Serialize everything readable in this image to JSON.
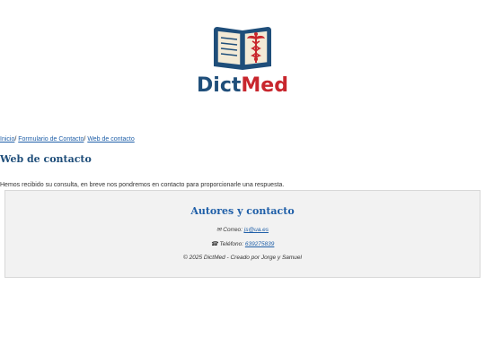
{
  "logo": {
    "text_part1": "Dict",
    "text_part2": "Med",
    "colors": {
      "dict": "#1f4e7a",
      "med": "#c8262d",
      "book_cover": "#1f4e7a",
      "page": "#f3ead6",
      "caduceus": "#c8262d"
    },
    "icon": "open-book-caduceus-icon"
  },
  "breadcrumb": {
    "items": [
      "Inicio",
      "Formulario de Contacto",
      "Web de contacto"
    ],
    "separator": "/"
  },
  "page": {
    "title": "Web de contacto",
    "message": "Hemos recibido su consulta, en breve nos pondremos en contacto para proporcionarle una respuesta."
  },
  "footer": {
    "title": "Autores y contacto",
    "email_icon": "✉",
    "email_label": "Correo:",
    "email": "js@ua.es",
    "phone_icon": "☎",
    "phone_label": "Teléfono:",
    "phone": "639275839",
    "copyright": "© 2025 DictMed - Creado por Jorge y Samuel"
  }
}
